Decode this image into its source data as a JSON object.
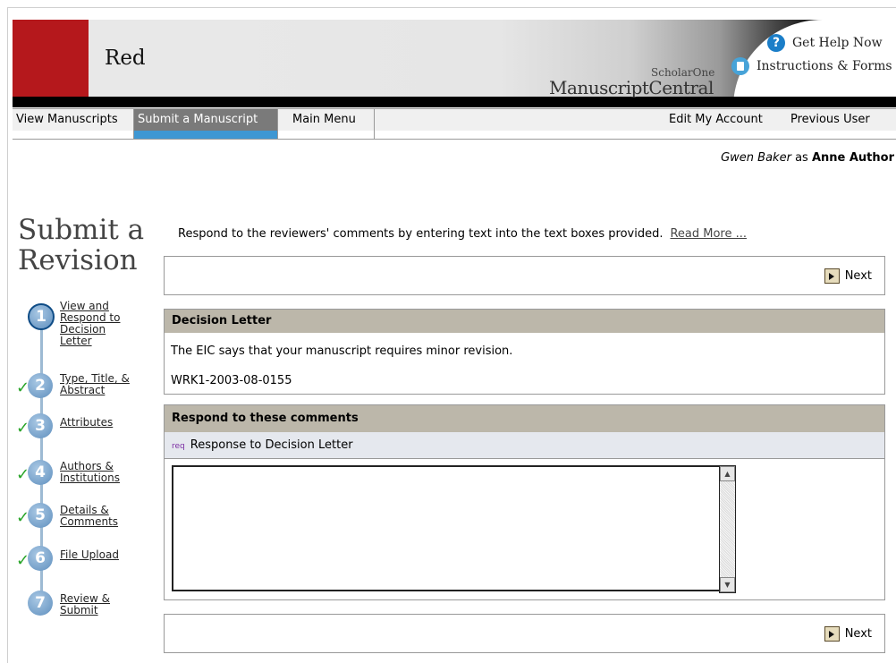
{
  "header": {
    "brand": "Red",
    "logo_small": "ScholarOne",
    "logo_big": "ManuscriptCentral",
    "help": [
      {
        "icon": "question-icon",
        "label": "Get Help Now"
      },
      {
        "icon": "document-icon",
        "label": "Instructions & Forms"
      }
    ],
    "colors": {
      "brand_red": "#b5181c",
      "nav_active": "#7a7a7a",
      "nav_underline": "#3e97d3"
    }
  },
  "nav": {
    "items": [
      {
        "label": "View Manuscripts",
        "active": false
      },
      {
        "label": "Submit a Manuscript",
        "active": true
      },
      {
        "label": "Main Menu",
        "active": false
      }
    ],
    "right": [
      "Edit My Account",
      "Previous User"
    ]
  },
  "user": {
    "name": "Gwen Baker",
    "as": "as",
    "role": "Anne Author"
  },
  "page": {
    "title": "Submit a Revision",
    "intro": "Respond to the reviewers' comments by entering text into the text boxes provided.",
    "read_more": "Read More ..."
  },
  "steps": [
    {
      "num": "1",
      "label": "View and Respond to Decision Letter",
      "done": false,
      "current": true
    },
    {
      "num": "2",
      "label": "Type, Title, & Abstract",
      "done": true,
      "current": false
    },
    {
      "num": "3",
      "label": "Attributes",
      "done": true,
      "current": false
    },
    {
      "num": "4",
      "label": "Authors & Institutions",
      "done": true,
      "current": false
    },
    {
      "num": "5",
      "label": "Details & Comments",
      "done": true,
      "current": false
    },
    {
      "num": "6",
      "label": "File Upload",
      "done": true,
      "current": false
    },
    {
      "num": "7",
      "label": "Review & Submit",
      "done": false,
      "current": false
    }
  ],
  "next_label": "Next",
  "decision": {
    "heading": "Decision Letter",
    "text": "The EIC says that your manuscript requires minor revision.",
    "manuscript_id": "WRK1-2003-08-0155"
  },
  "respond": {
    "heading": "Respond to these comments",
    "req": "req",
    "field_label": "Response to Decision Letter",
    "value": ""
  }
}
